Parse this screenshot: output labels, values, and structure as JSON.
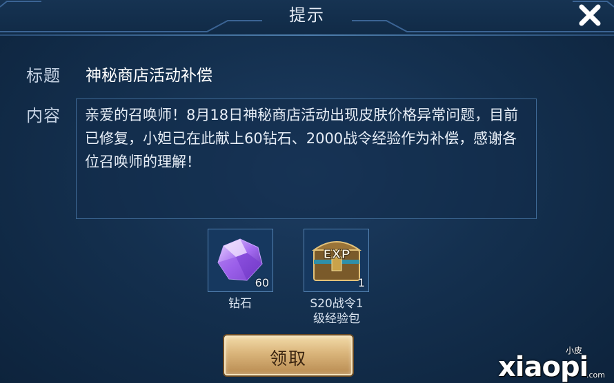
{
  "dialog": {
    "title": "提示",
    "close_icon": "close-x-icon"
  },
  "fields": {
    "title_label": "标题",
    "title_value": "神秘商店活动补偿",
    "content_label": "内容",
    "content_text": "亲爱的召唤师！8月18日神秘商店活动出现皮肤价格异常问题，目前已修复，小妲己在此献上60钻石、2000战令经验作为补偿，感谢各位召唤师的理解！"
  },
  "rewards": [
    {
      "name": "钻石",
      "count": "60",
      "icon": "purple-diamond-icon"
    },
    {
      "name": "S20战令1级经验包",
      "name_line1": "S20战令1",
      "name_line2": "级经验包",
      "count": "1",
      "icon": "exp-chest-icon"
    }
  ],
  "actions": {
    "claim_label": "领取"
  },
  "watermark": {
    "small": "小皮",
    "main": "xiaopi",
    "suffix": ".com"
  },
  "colors": {
    "background": "#14304f",
    "accent_gold": "#d9b47a",
    "border_blue": "#3f6a96"
  }
}
